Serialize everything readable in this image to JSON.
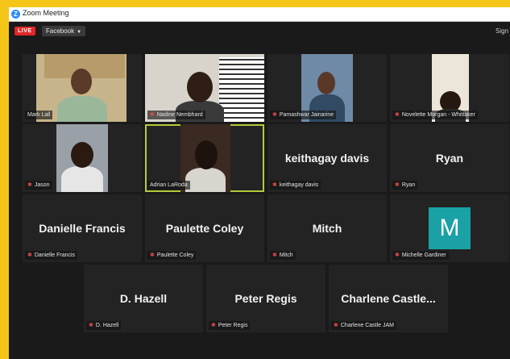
{
  "window": {
    "title": "Zoom Meeting",
    "app_icon": "Z"
  },
  "toolbar": {
    "live_label": "LIVE",
    "stream_target": "Facebook",
    "sign_text": "Sign"
  },
  "participants": [
    {
      "display_name": "",
      "label": "Mark Lall",
      "video": true,
      "mic_muted": false
    },
    {
      "display_name": "",
      "label": "Nadine Nembhard",
      "video": true,
      "mic_muted": true
    },
    {
      "display_name": "",
      "label": "Pamashwar Jainarine",
      "video": true,
      "mic_muted": true
    },
    {
      "display_name": "",
      "label": "Novelette Morgan - Whittaker",
      "video": true,
      "mic_muted": true
    },
    {
      "display_name": "",
      "label": "Jason",
      "video": true,
      "mic_muted": true
    },
    {
      "display_name": "",
      "label": "Adrian LaRoda",
      "video": true,
      "mic_muted": false,
      "active_speaker": true
    },
    {
      "display_name": "keithagay davis",
      "label": "keithagay davis",
      "video": false,
      "mic_muted": true
    },
    {
      "display_name": "Ryan",
      "label": "Ryan",
      "video": false,
      "mic_muted": true
    },
    {
      "display_name": "Danielle Francis",
      "label": "Danielle Francis",
      "video": false,
      "mic_muted": true
    },
    {
      "display_name": "Paulette Coley",
      "label": "Paulette Coley",
      "video": false,
      "mic_muted": true
    },
    {
      "display_name": "Mitch",
      "label": "Mitch",
      "video": false,
      "mic_muted": true
    },
    {
      "display_name": "",
      "label": "Michelle Gardiner",
      "video": false,
      "avatar_letter": "M",
      "avatar_color": "#1aa1a5",
      "mic_muted": true
    },
    {
      "display_name": "D. Hazell",
      "label": "D. Hazell",
      "video": false,
      "mic_muted": true
    },
    {
      "display_name": "Peter Regis",
      "label": "Peter Regis",
      "video": false,
      "mic_muted": true
    },
    {
      "display_name": "Charlene  Castle...",
      "label": "Charlene Castle  JAM",
      "video": false,
      "mic_muted": true
    }
  ],
  "colors": {
    "active_speaker_border": "#b5c93a",
    "live": "#e02828",
    "muted_mic": "#e34a4a"
  }
}
